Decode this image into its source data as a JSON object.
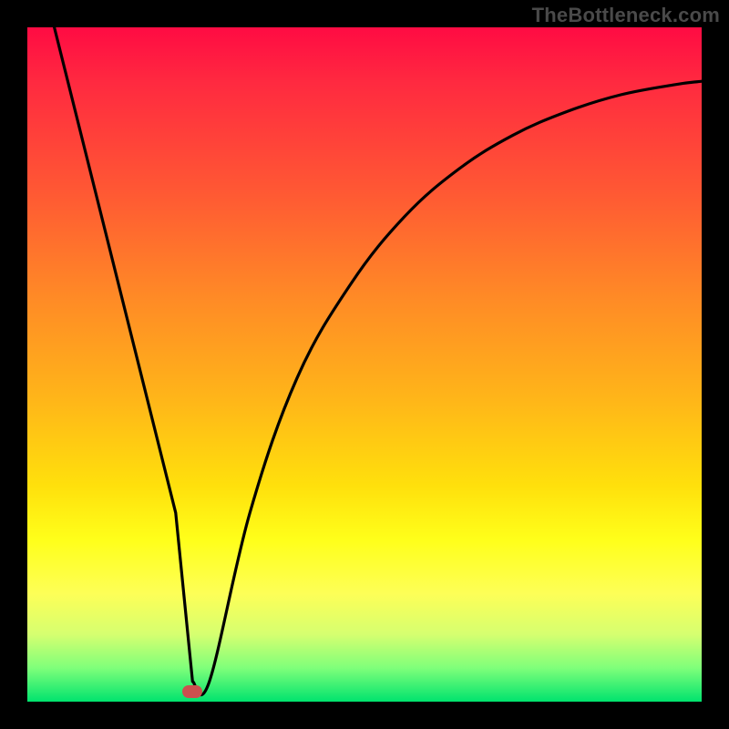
{
  "watermark": "TheBottleneck.com",
  "chart_data": {
    "type": "line",
    "title": "",
    "xlabel": "",
    "ylabel": "",
    "xlim": [
      0,
      100
    ],
    "ylim": [
      0,
      100
    ],
    "grid": false,
    "legend": false,
    "series": [
      {
        "name": "curve",
        "x": [
          4,
          10,
          16,
          22,
          24.5,
          27,
          33,
          40,
          48,
          56,
          64,
          72,
          80,
          88,
          96,
          100
        ],
        "values": [
          100,
          76,
          52,
          28,
          3,
          3,
          28,
          48,
          62,
          72,
          79,
          84,
          87.5,
          90,
          91.5,
          92
        ]
      }
    ],
    "marker": {
      "x": 24.5,
      "y": 1.5
    },
    "gradient_stops": [
      {
        "pos": 0,
        "color": "#ff0b43"
      },
      {
        "pos": 25,
        "color": "#ff5a33"
      },
      {
        "pos": 55,
        "color": "#ffb519"
      },
      {
        "pos": 80,
        "color": "#ffff1a"
      },
      {
        "pos": 100,
        "color": "#00e36e"
      }
    ]
  }
}
